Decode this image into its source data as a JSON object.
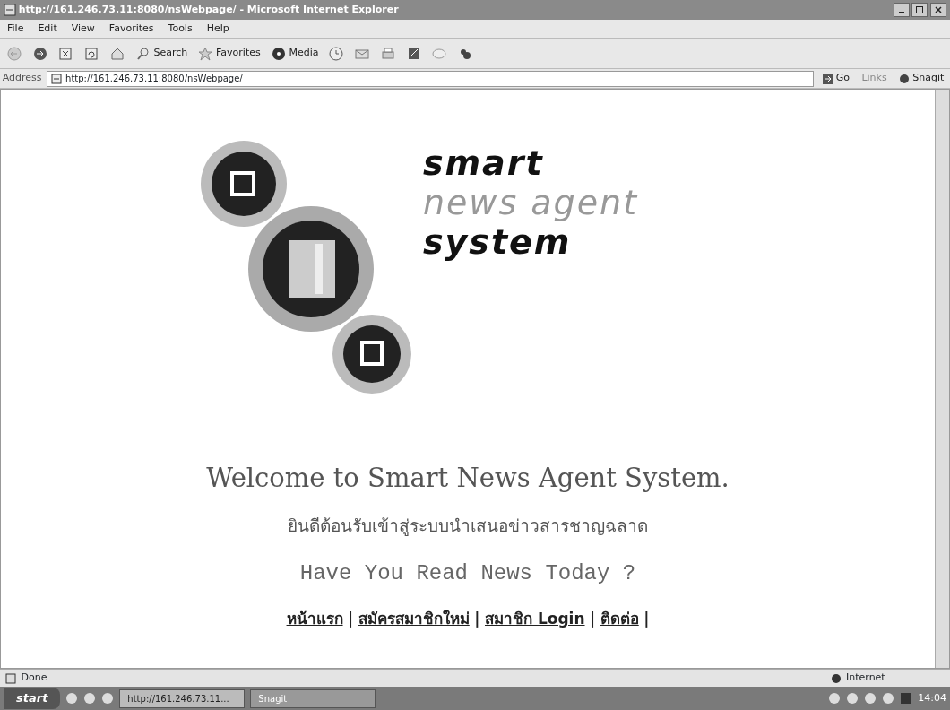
{
  "window": {
    "title": "http://161.246.73.11:8080/nsWebpage/ - Microsoft Internet Explorer"
  },
  "menu": [
    "File",
    "Edit",
    "View",
    "Favorites",
    "Tools",
    "Help"
  ],
  "toolbar": [
    {
      "kind": "back"
    },
    {
      "kind": "forward"
    },
    {
      "kind": "stop"
    },
    {
      "kind": "refresh"
    },
    {
      "kind": "home"
    },
    {
      "kind": "search",
      "label": "Search"
    },
    {
      "kind": "favorites",
      "label": "Favorites"
    },
    {
      "kind": "media",
      "label": "Media"
    },
    {
      "kind": "history"
    },
    {
      "kind": "mail"
    },
    {
      "kind": "print"
    },
    {
      "kind": "edit"
    },
    {
      "kind": "discuss"
    },
    {
      "kind": "messenger"
    }
  ],
  "address_bar": {
    "label": "Address",
    "value": "http://161.246.73.11:8080/nsWebpage/",
    "go": "Go",
    "links": "Links",
    "snagit": "Snagit"
  },
  "logo": {
    "lines": [
      {
        "text": "smart",
        "kind": "solid"
      },
      {
        "text": "news agent",
        "kind": "light"
      },
      {
        "text": "system",
        "kind": "solid"
      }
    ]
  },
  "welcome": "Welcome to Smart News Agent System.",
  "welcome_thai": "ยินดีต้อนรับเข้าสู่ระบบนำเสนอข่าวสารชาญฉลาด",
  "tagline": "Have You Read News Today ?",
  "nav_links": [
    {
      "label": "หน้าแรก",
      "separator": "|"
    },
    {
      "label": "สมัครสมาชิกใหม่",
      "separator": "|"
    },
    {
      "label": "สมาชิก Login",
      "separator": "|"
    },
    {
      "label": "ติดต่อ",
      "separator": "|"
    }
  ],
  "status_bar": {
    "text": "Done",
    "zone": "Internet"
  },
  "taskbar": {
    "start": "start",
    "tasks": [
      {
        "label": "http://161.246.73.11...",
        "selected": true
      },
      {
        "label": "Snagit",
        "selected": false
      }
    ],
    "clock": "14:04"
  }
}
